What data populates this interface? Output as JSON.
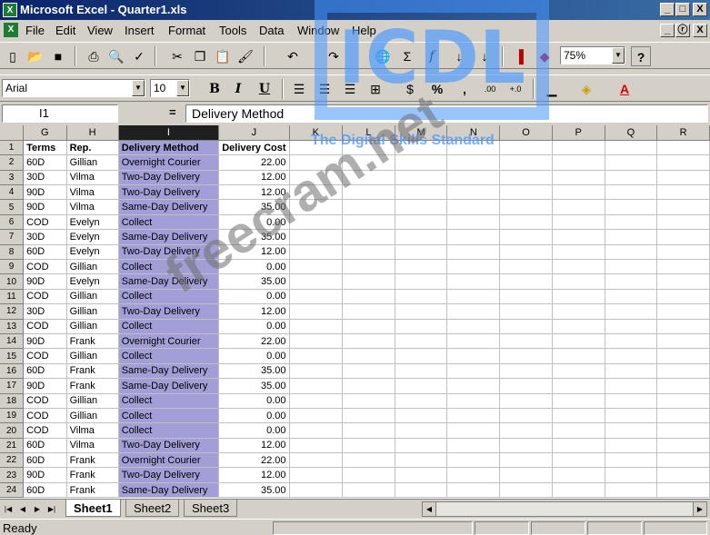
{
  "window": {
    "title": "Microsoft Excel - Quarter1.xls",
    "app_icon": "X",
    "controls": [
      "_",
      "□",
      "X"
    ],
    "doc_controls": [
      "_",
      "ⓡ",
      "X"
    ]
  },
  "menu": [
    "File",
    "Edit",
    "View",
    "Insert",
    "Format",
    "Tools",
    "Data",
    "Window",
    "Help"
  ],
  "toolbar": {
    "zoom": "75%",
    "font": "Arial",
    "size": "10",
    "bold": "B",
    "italic": "I",
    "underline": "U",
    "percent": "%",
    "comma": ",",
    "inc_dec": ".00",
    "dec_dec": "+.0",
    "sum": "Σ",
    "fx": "f",
    "help": "?"
  },
  "formula": {
    "name_box": "I1",
    "eq": "=",
    "content": "Delivery Method"
  },
  "columns": [
    "G",
    "H",
    "I",
    "J",
    "K",
    "L",
    "M",
    "N",
    "O",
    "P",
    "Q",
    "R"
  ],
  "rows": [
    [
      "Terms",
      "Rep.",
      "Delivery Method",
      "Delivery Cost"
    ],
    [
      "60D",
      "Gillian",
      "Overnight Courier",
      "22.00"
    ],
    [
      "30D",
      "Vilma",
      "Two-Day Delivery",
      "12.00"
    ],
    [
      "90D",
      "Vilma",
      "Two-Day Delivery",
      "12.00"
    ],
    [
      "90D",
      "Vilma",
      "Same-Day Delivery",
      "35.00"
    ],
    [
      "COD",
      "Evelyn",
      "Collect",
      "0.00"
    ],
    [
      "30D",
      "Evelyn",
      "Same-Day Delivery",
      "35.00"
    ],
    [
      "60D",
      "Evelyn",
      "Two-Day Delivery",
      "12.00"
    ],
    [
      "COD",
      "Gillian",
      "Collect",
      "0.00"
    ],
    [
      "90D",
      "Evelyn",
      "Same-Day Delivery",
      "35.00"
    ],
    [
      "COD",
      "Gillian",
      "Collect",
      "0.00"
    ],
    [
      "30D",
      "Gillian",
      "Two-Day Delivery",
      "12.00"
    ],
    [
      "COD",
      "Gillian",
      "Collect",
      "0.00"
    ],
    [
      "90D",
      "Frank",
      "Overnight Courier",
      "22.00"
    ],
    [
      "COD",
      "Gillian",
      "Collect",
      "0.00"
    ],
    [
      "60D",
      "Frank",
      "Same-Day Delivery",
      "35.00"
    ],
    [
      "90D",
      "Frank",
      "Same-Day Delivery",
      "35.00"
    ],
    [
      "COD",
      "Gillian",
      "Collect",
      "0.00"
    ],
    [
      "COD",
      "Gillian",
      "Collect",
      "0.00"
    ],
    [
      "COD",
      "Vilma",
      "Collect",
      "0.00"
    ],
    [
      "60D",
      "Vilma",
      "Two-Day Delivery",
      "12.00"
    ],
    [
      "60D",
      "Frank",
      "Overnight Courier",
      "22.00"
    ],
    [
      "90D",
      "Frank",
      "Two-Day Delivery",
      "12.00"
    ],
    [
      "60D",
      "Frank",
      "Same-Day Delivery",
      "35.00"
    ]
  ],
  "sheets": [
    "Sheet1",
    "Sheet2",
    "Sheet3"
  ],
  "status": "Ready",
  "overlay": {
    "logo": "ICDL",
    "logo_sub": "The Digital Skills Standard",
    "watermark": "freecram.net"
  }
}
